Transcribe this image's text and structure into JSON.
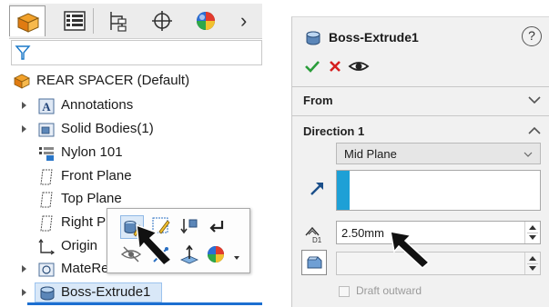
{
  "tree": {
    "root_label": "REAR SPACER  (Default)",
    "items": [
      {
        "label": "Annotations"
      },
      {
        "label": "Solid Bodies(1)"
      },
      {
        "label": "Nylon 101"
      },
      {
        "label": "Front Plane"
      },
      {
        "label": "Top Plane"
      },
      {
        "label": "Right P"
      },
      {
        "label": "Origin"
      },
      {
        "label": "MateReferences"
      },
      {
        "label": "Boss-Extrude1"
      }
    ],
    "tabs": [
      "feature-manager",
      "property-manager",
      "configuration-manager",
      "dimxpert-manager",
      "display-manager"
    ],
    "more_tabs_glyph": "›"
  },
  "property_manager": {
    "title": "Boss-Extrude1",
    "help_glyph": "?",
    "sections": {
      "from": "From",
      "direction1": "Direction 1"
    },
    "end_condition": "Mid Plane",
    "depth_value": "2.50mm",
    "depth_label": "D1",
    "draft_outward": "Draft outward"
  },
  "colors": {
    "accent_blue": "#1c6fd1",
    "ok_green": "#2a9d3a",
    "cancel_red": "#d61f1f",
    "direction_blue": "#1ea0d6"
  }
}
